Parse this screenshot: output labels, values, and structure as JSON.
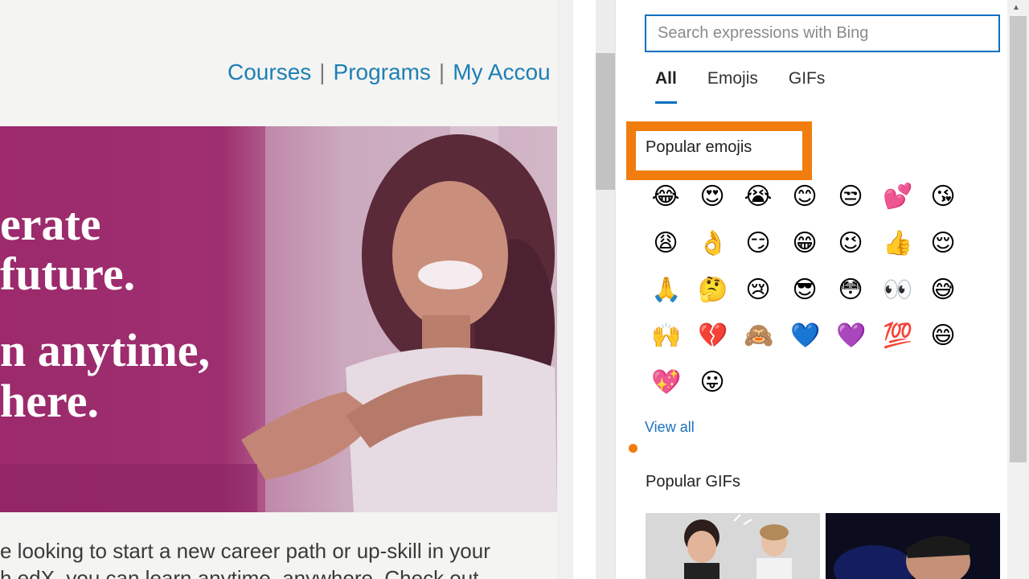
{
  "webpage": {
    "nav": {
      "courses": "Courses",
      "programs": "Programs",
      "account": "My Accou",
      "separator": "|"
    },
    "hero": {
      "line1": "erate",
      "line2": "future.",
      "line3": "n anytime,",
      "line4": "here."
    },
    "intro": {
      "line1": "e looking to start a new career path or up-skill in your",
      "line2": "h edX, you can learn anytime, anywhere. Check out"
    }
  },
  "panel": {
    "search": {
      "placeholder": "Search expressions with Bing",
      "value": ""
    },
    "tabs": [
      "All",
      "Emojis",
      "GIFs"
    ],
    "active_tab": "All",
    "popular_emojis_label": "Popular emojis",
    "view_all": "View all",
    "popular_gifs_label": "Popular GIFs",
    "highlight_color": "#f07d0e",
    "accent_color": "#0a6fbf",
    "emojis": [
      "face-with-tears-of-joy",
      "smiling-face-with-heart-eyes",
      "loudly-crying-face",
      "smiling-face",
      "unamused-face",
      "two-hearts",
      "face-blowing-kiss",
      "weary-face",
      "ok-hand",
      "smirking-face",
      "grinning-face-with-smiling-eyes",
      "winking-face",
      "thumbs-up",
      "relieved-face",
      "folded-hands",
      "thinking-face",
      "crying-face",
      "smiling-face-with-sunglasses",
      "flushed-face",
      "eyes",
      "grinning-face-with-sweat",
      "raising-hands",
      "broken-heart",
      "see-no-evil-monkey",
      "blue-heart",
      "purple-heart",
      "hundred-points",
      "beaming-face",
      "sparkling-heart",
      "face-with-tongue"
    ]
  }
}
